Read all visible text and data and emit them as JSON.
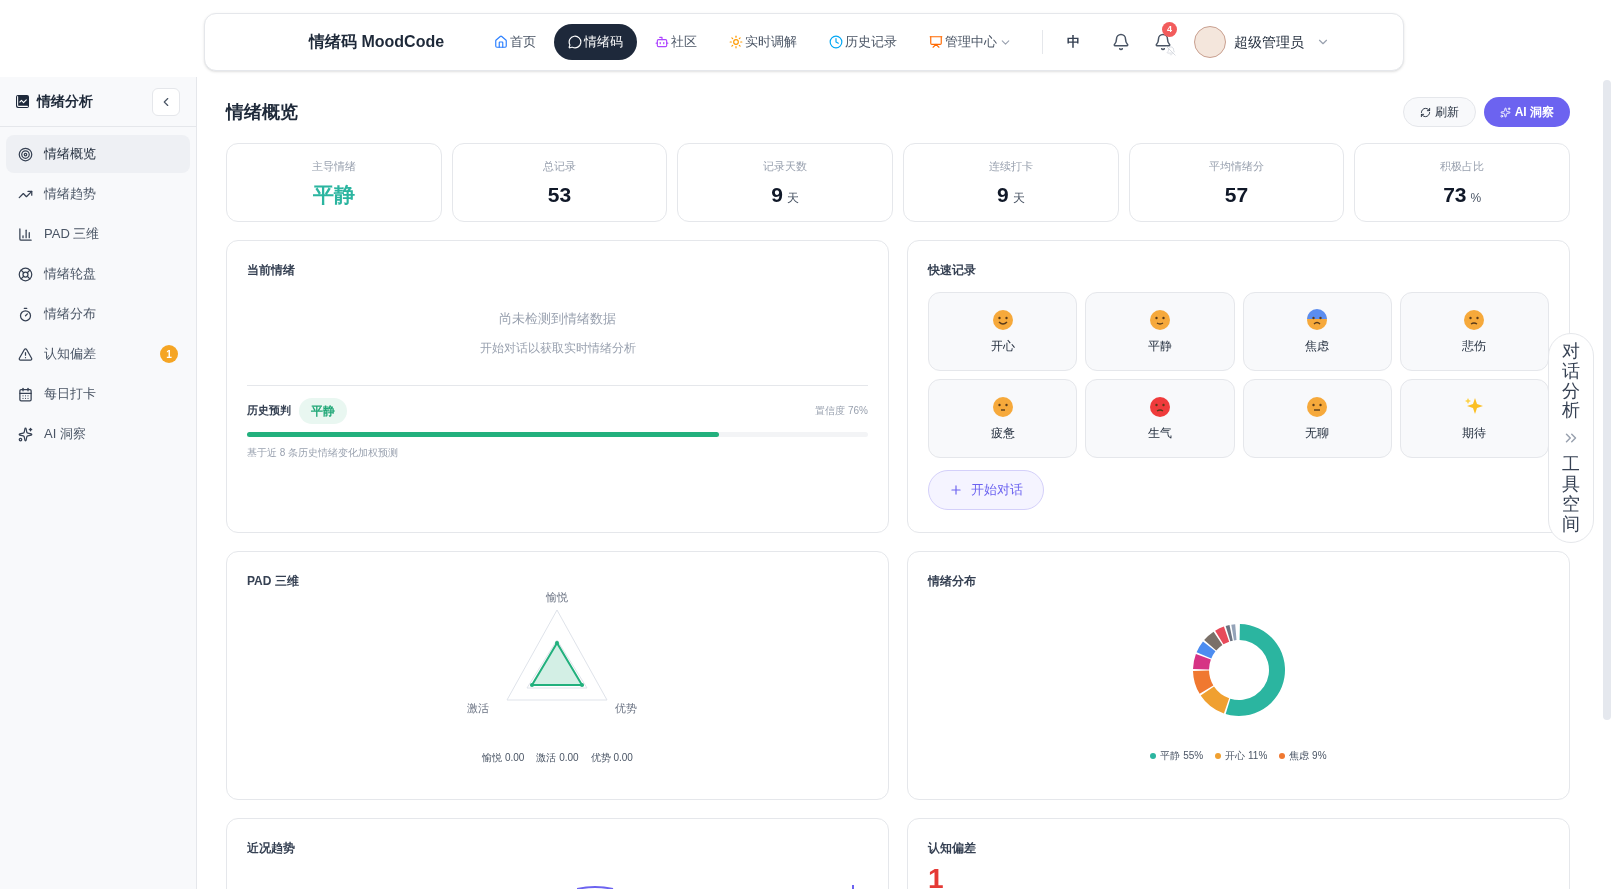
{
  "header": {
    "brand": "情绪码 MoodCode",
    "nav": [
      {
        "label": "首页",
        "selected": false
      },
      {
        "label": "情绪码",
        "selected": true
      },
      {
        "label": "社区",
        "selected": false
      },
      {
        "label": "实时调解",
        "selected": false
      },
      {
        "label": "历史记录",
        "selected": false
      },
      {
        "label": "管理中心",
        "selected": false,
        "dropdown": true
      }
    ],
    "language": "中",
    "notification_count": "4",
    "user": "超级管理员"
  },
  "sidebar": {
    "title": "情绪分析",
    "items": [
      {
        "label": "情绪概览",
        "selected": true
      },
      {
        "label": "情绪趋势",
        "selected": false
      },
      {
        "label": "PAD 三维",
        "selected": false
      },
      {
        "label": "情绪轮盘",
        "selected": false
      },
      {
        "label": "情绪分布",
        "selected": false
      },
      {
        "label": "认知偏差",
        "selected": false,
        "badge": "1"
      },
      {
        "label": "每日打卡",
        "selected": false
      },
      {
        "label": "AI 洞察",
        "selected": false
      }
    ]
  },
  "page": {
    "title": "情绪概览",
    "refresh_button": "刷新",
    "insight_button": "AI 洞察"
  },
  "stats": [
    {
      "label": "主导情绪",
      "value": "平静",
      "highlight": true
    },
    {
      "label": "总记录",
      "value": "53",
      "highlight": false
    },
    {
      "label": "记录天数",
      "value": "9",
      "unit": "天",
      "highlight": false
    },
    {
      "label": "连续打卡",
      "value": "9",
      "unit": "天",
      "highlight": false
    },
    {
      "label": "平均情绪分",
      "value": "57",
      "highlight": false
    },
    {
      "label": "积极占比",
      "value": "73",
      "unit": "%",
      "highlight": false
    }
  ],
  "current_emotion": {
    "title": "当前情绪",
    "empty_title": "尚未检测到情绪数据",
    "empty_hint": "开始对话以获取实时情绪分析",
    "prediction_label": "历史预判",
    "prediction": "平静",
    "confidence": "置信度 76%",
    "level": 0.76,
    "note": "基于近 8 条历史情绪变化加权预测"
  },
  "quick_record": {
    "title": "快速记录",
    "moods": [
      "开心",
      "平静",
      "焦虑",
      "悲伤",
      "疲惫",
      "生气",
      "无聊",
      "期待"
    ],
    "start_button": "开始对话"
  },
  "pad": {
    "title": "PAD 三维",
    "axes": [
      "愉悦",
      "激活",
      "优势"
    ],
    "readings": [
      "愉悦 0.00",
      "激活 0.00",
      "优势 0.00"
    ]
  },
  "distribution": {
    "title": "情绪分布",
    "legend": [
      {
        "label": "平静 55%",
        "color": "#2bb5a0"
      },
      {
        "label": "开心 11%",
        "color": "#f0a030"
      },
      {
        "label": "焦虑 9%",
        "color": "#f07830"
      }
    ]
  },
  "trend": {
    "title": "近况趋势"
  },
  "bias": {
    "title": "认知偏差",
    "count": "1"
  },
  "side_dock": {
    "top": "对话分析",
    "bottom": "工具空间"
  }
}
